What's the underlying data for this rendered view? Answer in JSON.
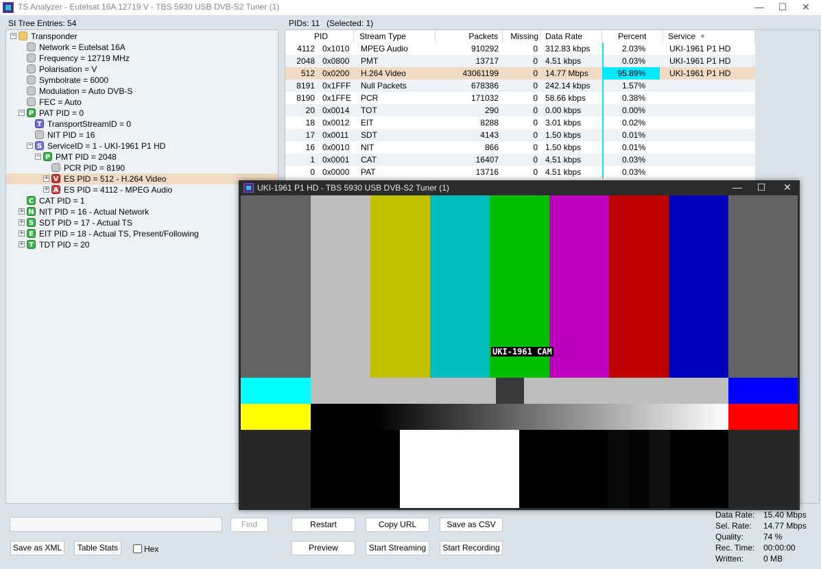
{
  "window": {
    "title": "TS Analyzer - Eutelsat 16A 12719 V - TBS 5930 USB DVB-S2 Tuner (1)"
  },
  "left": {
    "header": "SI Tree Entries: 54",
    "tree": [
      {
        "label": "Transponder",
        "icon": "folder",
        "level": 0,
        "toggle": "−",
        "name": "tree-transponder"
      },
      {
        "label": "Network = Eutelsat 16A",
        "icon": "leaf",
        "level": 1,
        "toggle": "",
        "name": "tree-network"
      },
      {
        "label": "Frequency = 12719 MHz",
        "icon": "leaf",
        "level": 1,
        "toggle": "",
        "name": "tree-frequency"
      },
      {
        "label": "Polarisation = V",
        "icon": "leaf",
        "level": 1,
        "toggle": "",
        "name": "tree-polarisation"
      },
      {
        "label": "Symbolrate = 6000",
        "icon": "leaf",
        "level": 1,
        "toggle": "",
        "name": "tree-symbolrate"
      },
      {
        "label": "Modulation = Auto DVB-S",
        "icon": "leaf",
        "level": 1,
        "toggle": "",
        "name": "tree-modulation"
      },
      {
        "label": "FEC = Auto",
        "icon": "leaf",
        "level": 1,
        "toggle": "",
        "name": "tree-fec"
      },
      {
        "label": "PAT PID = 0",
        "icon": "P",
        "level": 1,
        "toggle": "−",
        "name": "tree-pat"
      },
      {
        "label": "TransportStreamID = 0",
        "icon": "T",
        "level": 2,
        "toggle": "",
        "name": "tree-tsid"
      },
      {
        "label": "NIT PID = 16",
        "icon": "leaf",
        "level": 2,
        "toggle": "",
        "name": "tree-nit-pid"
      },
      {
        "label": "ServiceID = 1 - UKI-1961 P1 HD",
        "icon": "S",
        "level": 2,
        "toggle": "−",
        "name": "tree-service"
      },
      {
        "label": "PMT PID = 2048",
        "icon": "P",
        "level": 3,
        "toggle": "−",
        "name": "tree-pmt"
      },
      {
        "label": "PCR PID = 8190",
        "icon": "leaf",
        "level": 4,
        "toggle": "",
        "name": "tree-pcr"
      },
      {
        "label": "ES PID = 512 - H.264 Video",
        "icon": "V",
        "level": 4,
        "toggle": "+",
        "name": "tree-es-video",
        "selected": true
      },
      {
        "label": "ES PID = 4112 - MPEG Audio",
        "icon": "A",
        "level": 4,
        "toggle": "+",
        "name": "tree-es-audio"
      },
      {
        "label": "CAT PID = 1",
        "icon": "C",
        "level": 1,
        "toggle": "",
        "name": "tree-cat"
      },
      {
        "label": "NIT PID = 16 - Actual Network",
        "icon": "N",
        "level": 1,
        "toggle": "+",
        "name": "tree-nit"
      },
      {
        "label": "SDT PID = 17 - Actual TS",
        "icon": "S2",
        "level": 1,
        "toggle": "+",
        "name": "tree-sdt"
      },
      {
        "label": "EIT PID = 18 - Actual TS, Present/Following",
        "icon": "E",
        "level": 1,
        "toggle": "+",
        "name": "tree-eit"
      },
      {
        "label": "TDT PID = 20",
        "icon": "Tg",
        "level": 1,
        "toggle": "+",
        "name": "tree-tdt"
      }
    ],
    "icon_letters": {
      "P": "P",
      "T": "T",
      "S": "S",
      "V": "V",
      "A": "A",
      "C": "C",
      "N": "N",
      "S2": "S",
      "E": "E",
      "Tg": "T"
    },
    "search_value": "",
    "find_label": "Find",
    "save_xml_label": "Save as XML",
    "table_stats_label": "Table Stats",
    "hex_label": "Hex"
  },
  "right": {
    "header": "PIDs: 11   (Selected: 1)",
    "columns": {
      "pid": "PID",
      "stream_type": "Stream Type",
      "packets": "Packets",
      "missing": "Missing",
      "data_rate": "Data Rate",
      "percent": "Percent",
      "service": "Service"
    },
    "rows": [
      {
        "pid": "4112",
        "hex": "0x1010",
        "type": "MPEG Audio",
        "packets": "910292",
        "missing": "0",
        "rate": "312.83 kbps",
        "percent": "2.03%",
        "pct": 2.03,
        "service": "UKI-1961 P1 HD"
      },
      {
        "pid": "2048",
        "hex": "0x0800",
        "type": "PMT",
        "packets": "13717",
        "missing": "0",
        "rate": "4.51 kbps",
        "percent": "0.03%",
        "pct": 0.03,
        "service": "UKI-1961 P1 HD"
      },
      {
        "pid": "512",
        "hex": "0x0200",
        "type": "H.264 Video",
        "packets": "43061199",
        "missing": "0",
        "rate": "14.77 Mbps",
        "percent": "95.89%",
        "pct": 95.89,
        "service": "UKI-1961 P1 HD",
        "selected": true
      },
      {
        "pid": "8191",
        "hex": "0x1FFF",
        "type": "Null Packets",
        "packets": "678386",
        "missing": "0",
        "rate": "242.14 kbps",
        "percent": "1.57%",
        "pct": 1.57,
        "service": ""
      },
      {
        "pid": "8190",
        "hex": "0x1FFE",
        "type": "PCR",
        "packets": "171032",
        "missing": "0",
        "rate": "58.66 kbps",
        "percent": "0.38%",
        "pct": 0.38,
        "service": ""
      },
      {
        "pid": "20",
        "hex": "0x0014",
        "type": "TOT",
        "packets": "290",
        "missing": "0",
        "rate": "0.00 kbps",
        "percent": "0.00%",
        "pct": 0.0,
        "service": ""
      },
      {
        "pid": "18",
        "hex": "0x0012",
        "type": "EIT",
        "packets": "8288",
        "missing": "0",
        "rate": "3.01 kbps",
        "percent": "0.02%",
        "pct": 0.02,
        "service": ""
      },
      {
        "pid": "17",
        "hex": "0x0011",
        "type": "SDT",
        "packets": "4143",
        "missing": "0",
        "rate": "1.50 kbps",
        "percent": "0.01%",
        "pct": 0.01,
        "service": ""
      },
      {
        "pid": "16",
        "hex": "0x0010",
        "type": "NIT",
        "packets": "866",
        "missing": "0",
        "rate": "1.50 kbps",
        "percent": "0.01%",
        "pct": 0.01,
        "service": ""
      },
      {
        "pid": "1",
        "hex": "0x0001",
        "type": "CAT",
        "packets": "16407",
        "missing": "0",
        "rate": "4.51 kbps",
        "percent": "0.03%",
        "pct": 0.03,
        "service": ""
      },
      {
        "pid": "0",
        "hex": "0x0000",
        "type": "PAT",
        "packets": "13716",
        "missing": "0",
        "rate": "4.51 kbps",
        "percent": "0.03%",
        "pct": 0.03,
        "service": ""
      }
    ],
    "buttons": {
      "restart": "Restart",
      "copy_url": "Copy URL",
      "save_csv": "Save as CSV",
      "preview": "Preview",
      "start_streaming": "Start Streaming",
      "start_recording": "Start Recording"
    },
    "stats": [
      {
        "label": "Data Rate:",
        "value": "15.40 Mbps"
      },
      {
        "label": "Sel. Rate:",
        "value": "14.77 Mbps"
      },
      {
        "label": "Quality:",
        "value": "74 %"
      },
      {
        "label": "Rec. Time:",
        "value": "00:00:00"
      },
      {
        "label": "Written:",
        "value": "0 MB"
      }
    ]
  },
  "video": {
    "title": "UKI-1961 P1 HD - TBS 5930 USB DVB-S2 Tuner (1)",
    "overlay": "UKI-1961 CAM",
    "colors": {
      "gray": "#646464",
      "light_gray": "#bebebe",
      "yellow": "#c0c000",
      "cyan": "#00bebe",
      "green": "#00bf00",
      "magenta": "#bf00bf",
      "red": "#bf0000",
      "blue": "#0000bf",
      "bright_cyan": "#00ffff",
      "bright_blue": "#0000ff",
      "bright_yellow": "#ffff00",
      "bright_red": "#ff0000",
      "dark": "#262626",
      "white": "#ffffff",
      "black": "#000000"
    }
  },
  "colors": {
    "selection": "#f0dac3",
    "percent_bar": "#00e8ff",
    "panel_bg": "#dbe3ea"
  }
}
